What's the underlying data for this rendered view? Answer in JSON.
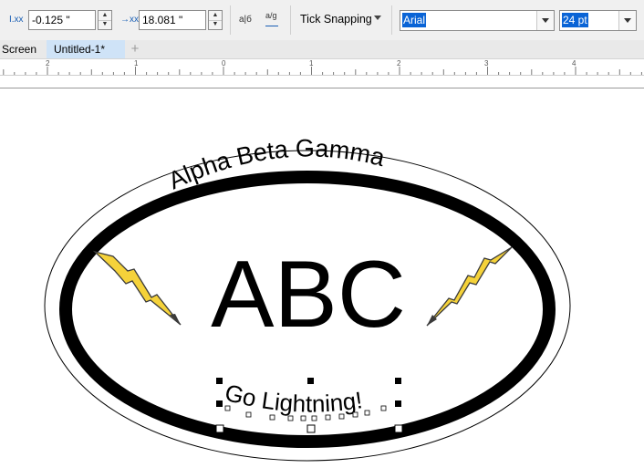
{
  "toolbar": {
    "x_label": "I.xx",
    "x_value": "-0.125 \"",
    "y_label": "→xx",
    "y_value": "18.081 \"",
    "char_spacing_label": "a|б",
    "vertical_text_label": "a/g",
    "snap_label": "Tick Snapping",
    "font_name": "Arial",
    "font_size": "24 pt"
  },
  "tabs": {
    "screen": "Screen",
    "document": "Untitled-1*",
    "add": "+"
  },
  "ruler": {
    "labels": [
      "2",
      "1",
      "0",
      "1",
      "2",
      "3",
      "4"
    ]
  },
  "artwork": {
    "arc_text": "Alpha Beta Gamma",
    "main_text": "ABC",
    "bottom_text": "Go Lightning!"
  },
  "colors": {
    "accent": "#0a64d6",
    "lightning_fill": "#f5d23a",
    "stroke": "#000000"
  }
}
